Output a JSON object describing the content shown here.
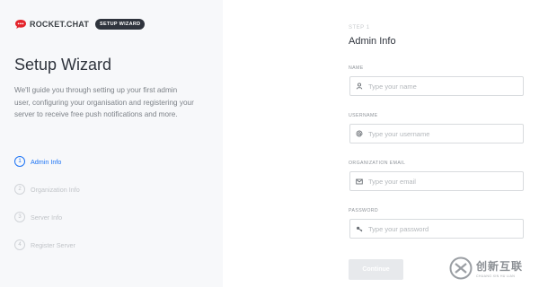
{
  "brand": {
    "name": "ROCKET.CHAT",
    "badge": "SETUP WIZARD",
    "color": "#e3242b"
  },
  "sidebar": {
    "title": "Setup Wizard",
    "description": "We'll guide you through setting up your first admin user, configuring your organisation and registering your server to receive free push notifications and more.",
    "steps": [
      {
        "num": "1",
        "label": "Admin Info",
        "active": true
      },
      {
        "num": "2",
        "label": "Organization Info",
        "active": false
      },
      {
        "num": "3",
        "label": "Server Info",
        "active": false
      },
      {
        "num": "4",
        "label": "Register Server",
        "active": false
      }
    ]
  },
  "form": {
    "step_caption": "STEP 1",
    "title": "Admin Info",
    "fields": [
      {
        "label": "NAME",
        "icon": "user-icon",
        "placeholder": "Type your name",
        "value": ""
      },
      {
        "label": "USERNAME",
        "icon": "at-sign-icon",
        "placeholder": "Type your username",
        "value": ""
      },
      {
        "label": "ORGANIZATION EMAIL",
        "icon": "mail-icon",
        "placeholder": "Type your email",
        "value": ""
      },
      {
        "label": "PASSWORD",
        "icon": "key-icon",
        "placeholder": "Type your password",
        "value": ""
      }
    ],
    "continue_label": "Continue"
  },
  "watermark": {
    "cn": "创新互联",
    "en": "CHUANG XIN HU LIAN"
  }
}
